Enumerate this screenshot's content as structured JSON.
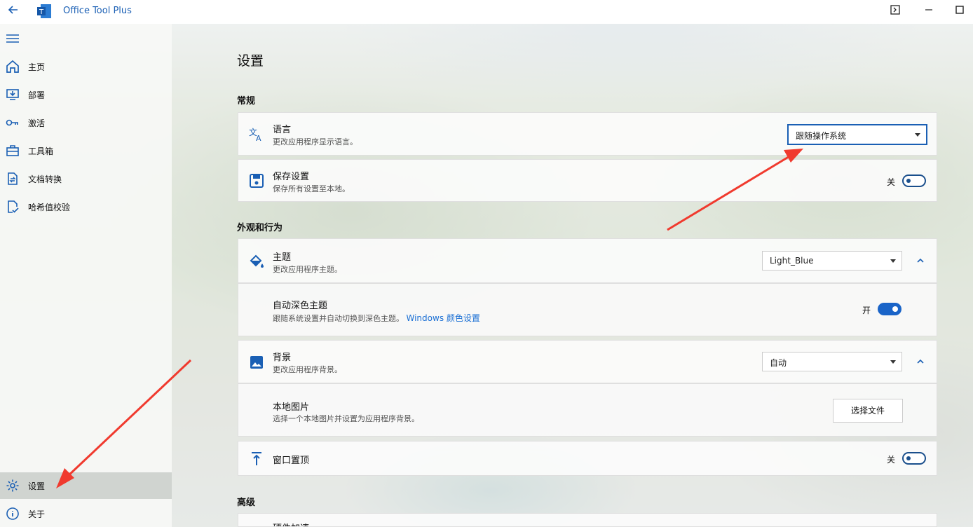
{
  "app": {
    "title": "Office Tool Plus",
    "logo_letter": "T"
  },
  "window_controls": {
    "compact_label": "▣",
    "minimize_label": "—",
    "maximize_label": "☐"
  },
  "sidebar": {
    "items": [
      {
        "label": "主页",
        "icon": "home-icon"
      },
      {
        "label": "部署",
        "icon": "deploy-icon"
      },
      {
        "label": "激活",
        "icon": "key-icon"
      },
      {
        "label": "工具箱",
        "icon": "toolbox-icon"
      },
      {
        "label": "文档转换",
        "icon": "convert-icon"
      },
      {
        "label": "哈希值校验",
        "icon": "hash-check-icon"
      }
    ],
    "bottom_items": [
      {
        "label": "设置",
        "icon": "gear-icon",
        "active": true
      },
      {
        "label": "关于",
        "icon": "info-icon"
      }
    ]
  },
  "page": {
    "title": "设置"
  },
  "sections": {
    "general": "常规",
    "appearance": "外观和行为",
    "advanced": "高级"
  },
  "settings": {
    "language": {
      "title": "语言",
      "desc": "更改应用程序显示语言。",
      "value": "跟随操作系统"
    },
    "save": {
      "title": "保存设置",
      "desc": "保存所有设置至本地。",
      "state_label": "关",
      "on": false
    },
    "theme": {
      "title": "主题",
      "desc": "更改应用程序主题。",
      "value": "Light_Blue"
    },
    "auto_dark": {
      "title": "自动深色主题",
      "desc": "跟随系统设置并自动切换到深色主题。",
      "link": "Windows 颜色设置",
      "state_label": "开",
      "on": true
    },
    "background": {
      "title": "背景",
      "desc": "更改应用程序背景。",
      "value": "自动"
    },
    "local_image": {
      "title": "本地图片",
      "desc": "选择一个本地图片并设置为应用程序背景。",
      "button": "选择文件"
    },
    "topmost": {
      "title": "窗口置顶",
      "state_label": "关",
      "on": false
    },
    "hardware_accel": {
      "title": "硬件加速"
    }
  },
  "colors": {
    "accent": "#1a5fb4",
    "annotation_arrow": "#f03a2e"
  }
}
